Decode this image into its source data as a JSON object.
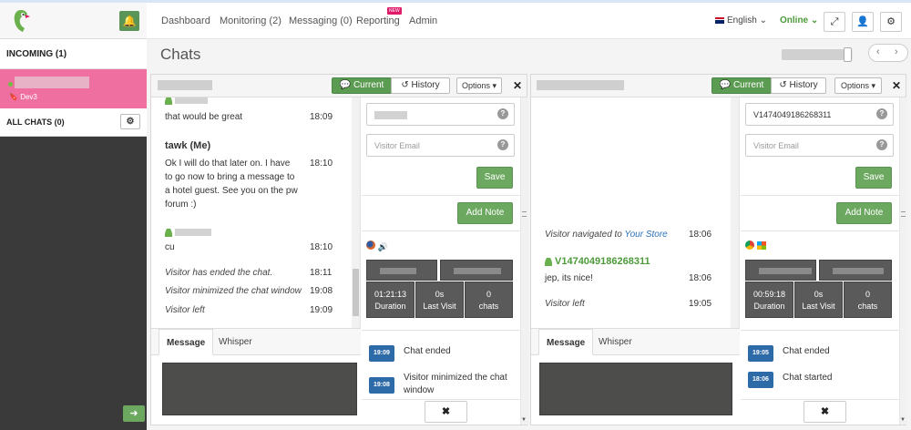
{
  "sidebar": {
    "incoming_label": "INCOMING (1)",
    "active_chat": {
      "department": "Dev3"
    },
    "all_chats_label": "ALL CHATS (0)"
  },
  "topnav": {
    "links": [
      "Dashboard",
      "Monitoring (2)",
      "Messaging (0)",
      "Reporting",
      "Admin"
    ],
    "new_badge": "NEW",
    "language": "English",
    "status": "Online"
  },
  "page": {
    "title": "Chats",
    "zoom_level_fraction": 0.9
  },
  "chats": [
    {
      "tabs": {
        "current": "Current",
        "history": "History",
        "options": "Options"
      },
      "messages": {
        "first_text": "that would be great",
        "first_time": "18:09",
        "agent_name": "tawk (Me)",
        "agent_text": [
          "Ok I will do that later on. I have",
          "to go now to bring a message to",
          "a hotel guest. See you on the pw",
          "forum :)"
        ],
        "agent_time": "18:10",
        "cu_text": "cu",
        "cu_time": "18:10",
        "sys1": "Visitor has ended the chat.",
        "sys1_time": "18:11",
        "sys2": "Visitor minimized the chat window",
        "sys2_time": "19:08",
        "sys3": "Visitor left",
        "sys3_time": "19:09"
      },
      "compose": {
        "tab_message": "Message",
        "tab_whisper": "Whisper"
      },
      "info": {
        "email_placeholder": "Visitor Email",
        "save": "Save",
        "add_note": "Add Note",
        "stats": [
          {
            "value": "01:21:13",
            "label": "Duration"
          },
          {
            "value": "0s",
            "label": "Last Visit"
          },
          {
            "value": "0",
            "label": "chats"
          }
        ],
        "events": [
          {
            "time": "19:09",
            "text": "Chat ended"
          },
          {
            "time": "19:08",
            "text": "Visitor minimized the chat window"
          }
        ],
        "close": "✖"
      }
    },
    {
      "tabs": {
        "current": "Current",
        "history": "History",
        "options": "Options"
      },
      "messages": {
        "nav_prefix": "Visitor navigated to ",
        "nav_link": "Your Store",
        "nav_time": "18:06",
        "visitor_name": "V1474049186268311",
        "visitor_text": "jep, its nice!",
        "visitor_time": "18:06",
        "sys_left": "Visitor left",
        "sys_left_time": "19:05"
      },
      "compose": {
        "tab_message": "Message",
        "tab_whisper": "Whisper"
      },
      "info": {
        "name_value": "V1474049186268311",
        "email_placeholder": "Visitor Email",
        "save": "Save",
        "add_note": "Add Note",
        "stats": [
          {
            "value": "00:59:18",
            "label": "Duration"
          },
          {
            "value": "0s",
            "label": "Last Visit"
          },
          {
            "value": "0",
            "label": "chats"
          }
        ],
        "events": [
          {
            "time": "19:05",
            "text": "Chat ended"
          },
          {
            "time": "18:06",
            "text": "Chat started"
          }
        ],
        "close": "✖"
      }
    }
  ],
  "colors": {
    "accent_green": "#5b9b52",
    "active_pink": "#f06fa1",
    "badge_blue": "#2c6aa8"
  }
}
